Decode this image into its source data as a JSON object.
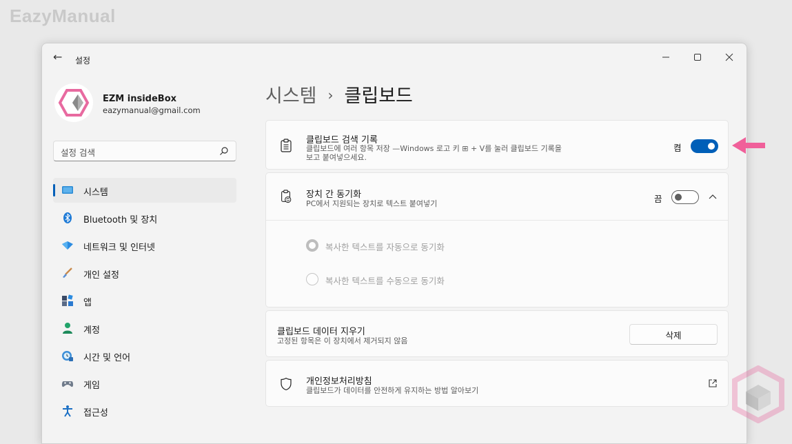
{
  "watermark": "EazyManual",
  "window": {
    "title": "설정",
    "back_icon": "back-arrow-icon"
  },
  "profile": {
    "name": "EZM insideBox",
    "email": "eazymanual@gmail.com"
  },
  "search": {
    "placeholder": "설정 검색"
  },
  "nav": {
    "items": [
      {
        "label": "시스템",
        "icon": "system-icon",
        "active": true
      },
      {
        "label": "Bluetooth 및 장치",
        "icon": "bluetooth-icon"
      },
      {
        "label": "네트워크 및 인터넷",
        "icon": "network-icon"
      },
      {
        "label": "개인 설정",
        "icon": "brush-icon"
      },
      {
        "label": "앱",
        "icon": "apps-icon"
      },
      {
        "label": "계정",
        "icon": "account-icon"
      },
      {
        "label": "시간 및 언어",
        "icon": "time-language-icon"
      },
      {
        "label": "게임",
        "icon": "gaming-icon"
      },
      {
        "label": "접근성",
        "icon": "accessibility-icon"
      }
    ]
  },
  "breadcrumb": {
    "parent": "시스템",
    "separator": "›",
    "current": "클립보드"
  },
  "clipboard_history": {
    "title": "클립보드 검색 기록",
    "desc_line1": "클립보드에 여러 항목 저장 —Windows 로고 키 ⊞ + V를 눌러 클립보드 기록을",
    "desc_line2": "보고 붙여넣으세요.",
    "state": "켬",
    "on": true
  },
  "sync": {
    "title": "장치 간 동기화",
    "desc": "PC에서 지원되는 장치로 텍스트 붙여넣기",
    "state": "끔",
    "on": false,
    "options": [
      {
        "label": "복사한 텍스트를 자동으로 동기화",
        "selected": true
      },
      {
        "label": "복사한 텍스트를 수동으로 동기화",
        "selected": false
      }
    ]
  },
  "clear_data": {
    "title": "클립보드 데이터 지우기",
    "desc": "고정된 항목은 이 장치에서 제거되지 않음",
    "button": "삭제"
  },
  "privacy": {
    "title": "개인정보처리방침",
    "desc": "클립보드가 데이터를 안전하게 유지하는 방법 알아보기"
  },
  "colors": {
    "accent": "#005fb8",
    "annotation": "#f0609a"
  }
}
